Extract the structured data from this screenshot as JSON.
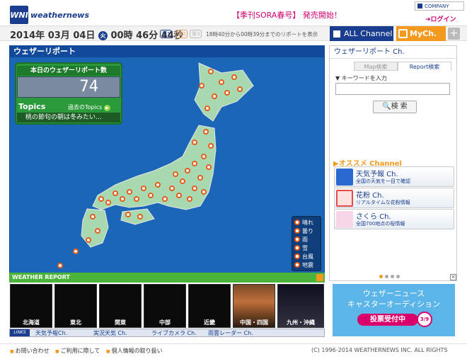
{
  "header": {
    "logo_mark": "WNI",
    "logo_word": "weathernews",
    "promo": "【季刊SORA春号】 発売開始！",
    "company": "COMPANY",
    "login": "ログイン"
  },
  "datebar": {
    "date": "2014年 03月 04日",
    "day_of_week": "火",
    "time": "00時 46分 44秒",
    "period_badges": [
      "第1",
      "第2",
      "第3"
    ],
    "range_text": "18時40分から00時39分までのリポートを表示",
    "tab_all": "ALL Channel",
    "tab_my": "MyCh.",
    "tab_plus": "+"
  },
  "map_panel": {
    "title": "ウェザーリポート",
    "count_label": "本日のウェザーリポート数",
    "count_value": "74",
    "topics_label": "Topics",
    "topics_past": "過去のTopics",
    "topics_text": "桃の節句の朝は冬みたい…",
    "legend": [
      "晴れ",
      "曇り",
      "雨",
      "雪",
      "台風",
      "地震"
    ]
  },
  "weather_report": {
    "label": "WEATHER REPORT",
    "regions": [
      "北海道",
      "東北",
      "関東",
      "中部",
      "近畿",
      "中国・四国",
      "九州・沖縄"
    ],
    "links_tag": "LINKS",
    "links": [
      "天気予報Ch.",
      "実況天気 Ch.",
      "ライブカメラ Ch.",
      "雨雲レーダー Ch."
    ]
  },
  "right_panel": {
    "title": "ウェザーリポート Ch.",
    "tab_map": "Map検索",
    "tab_report": "Report検索",
    "keyword_label": "▼ キーワードを入力",
    "keyword_value": "",
    "search_button": "検 索",
    "osusume_label": "オススメ Channel",
    "channels": [
      {
        "name": "天気予報 Ch.",
        "desc": "全国の天気を一目で確認",
        "icon_color": "#2a6ad0"
      },
      {
        "name": "花粉 Ch.",
        "desc": "リアルタイムな花粉情報",
        "icon_color": "#e44a4a"
      },
      {
        "name": "さくら Ch.",
        "desc": "全国700地点の桜情報",
        "icon_color": "#f0a0c8"
      }
    ],
    "ad_close": "×",
    "ad_line1": "ウェザーニュース",
    "ad_line2": "キャスターオーディション",
    "ad_button": "投票受付中",
    "ad_date": "3/9"
  },
  "footer": {
    "links": [
      "お問い合わせ",
      "ご利用に際して",
      "個人情報の取り扱い"
    ],
    "copyright": "(C) 1996-2014 WEATHERNEWS INC. ALL RIGHTS"
  },
  "colors": {
    "brand_blue": "#1a3d8f",
    "map_sea": "#1c66b8",
    "land": "#a8d8b0",
    "accent_orange": "#f39a1e",
    "report_green": "#4ab33a"
  }
}
